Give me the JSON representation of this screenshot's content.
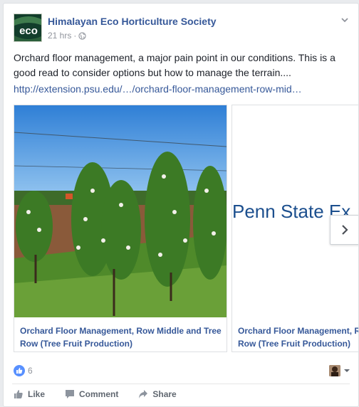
{
  "post": {
    "page_name": "Himalayan Eco Horticulture Society",
    "avatar_text": "eco",
    "time": "21 hrs",
    "separator": "·",
    "privacy_icon": "globe-icon",
    "options_icon": "chevron-down-icon",
    "text": "Orchard floor management, a major pain point in our conditions. This is a good read to consider options but how to manage the terrain....",
    "link": "http://extension.psu.edu/…/orchard-floor-management-row-mid…"
  },
  "attachments": [
    {
      "caption": "Orchard Floor Management, Row Middle and Tree Row (Tree Fruit Production)",
      "image": "orchard-photo"
    },
    {
      "caption": "Orchard Floor Management, Row Middle and Tree Row (Tree Fruit Production)",
      "image_text": "Penn State Ex"
    }
  ],
  "carousel": {
    "next_icon": "chevron-right-icon"
  },
  "reactions": {
    "count": "6",
    "icon": "like-icon"
  },
  "actions": {
    "like": "Like",
    "comment": "Comment",
    "share": "Share"
  },
  "colors": {
    "link": "#365899",
    "like_blue": "#5890ff",
    "psu_blue": "#1c4f8e"
  }
}
